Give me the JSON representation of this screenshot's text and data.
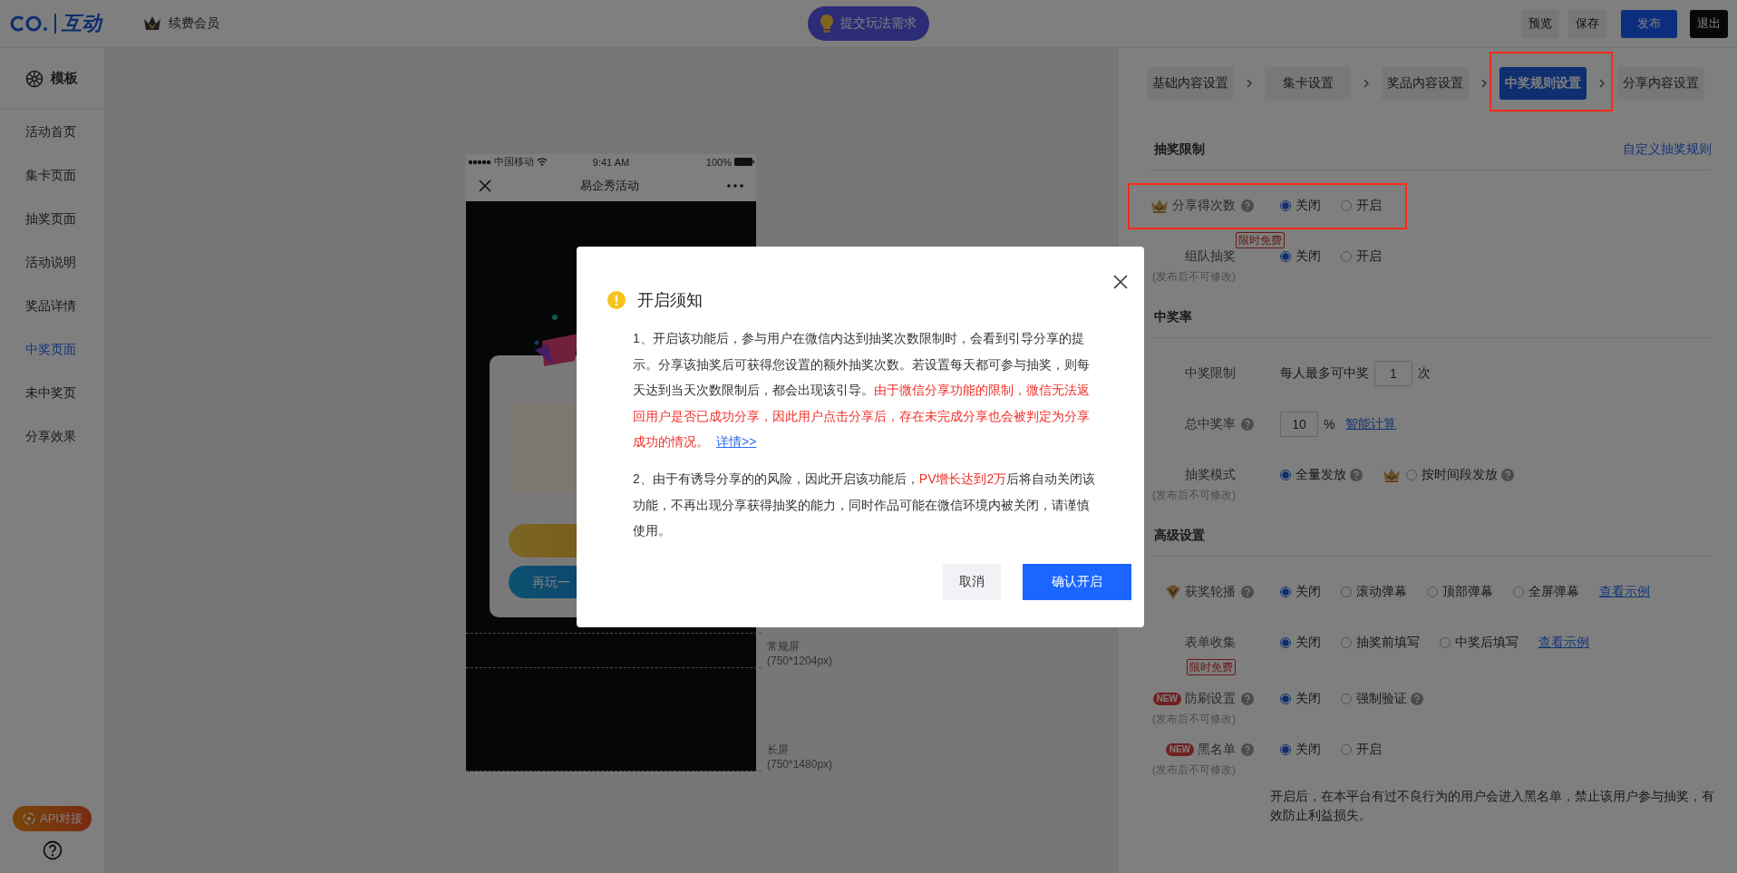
{
  "top_bar": {
    "logo_text": "互动",
    "member": "续费会员",
    "request_button": "提交玩法需求",
    "actions": [
      {
        "label": "预览",
        "kind": "plain"
      },
      {
        "label": "保存",
        "kind": "plain"
      },
      {
        "label": "发布",
        "kind": "primary"
      },
      {
        "label": "退出",
        "kind": "dark"
      }
    ]
  },
  "sidebar": {
    "header": "模板",
    "items": [
      {
        "label": "活动首页",
        "selected": false
      },
      {
        "label": "集卡页面",
        "selected": false
      },
      {
        "label": "抽奖页面",
        "selected": false
      },
      {
        "label": "活动说明",
        "selected": false
      },
      {
        "label": "奖品详情",
        "selected": false
      },
      {
        "label": "中奖页面",
        "selected": true
      },
      {
        "label": "未中奖页",
        "selected": false
      },
      {
        "label": "分享效果",
        "selected": false
      }
    ],
    "api_button": "API对接"
  },
  "phone": {
    "carrier": "中国移动",
    "time": "9:41 AM",
    "battery": "100%",
    "title": "易企秀活动",
    "replay_button": "再玩一",
    "screen_sizes": [
      {
        "name": "常规屏",
        "size": "(750*1204px)"
      },
      {
        "name": "长屏",
        "size": "(750*1480px)"
      }
    ]
  },
  "steps": [
    {
      "label": "基础内容设置",
      "selected": false,
      "highlighted": false
    },
    {
      "label": "集卡设置",
      "selected": false,
      "highlighted": false
    },
    {
      "label": "奖品内容设置",
      "selected": false,
      "highlighted": false
    },
    {
      "label": "中奖规则设置",
      "selected": true,
      "highlighted": true
    },
    {
      "label": "分享内容设置",
      "selected": false,
      "highlighted": false
    }
  ],
  "sections": [
    {
      "title": "抽奖限制",
      "link": "自定义抽奖规则",
      "rows": [
        {
          "kind": "radio",
          "label": "分享得次数",
          "help": true,
          "highlighted": true,
          "options": [
            {
              "label": "关闭",
              "selected": true
            },
            {
              "label": "开启",
              "selected": false
            }
          ]
        },
        {
          "kind": "radio",
          "label": "组队抽奖",
          "badge": "限时免费",
          "note": "(发布后不可修改)",
          "options": [
            {
              "label": "关闭",
              "selected": true
            },
            {
              "label": "开启",
              "selected": false
            }
          ]
        }
      ]
    },
    {
      "title": "中奖率",
      "rows": [
        {
          "kind": "limit",
          "label": "中奖限制",
          "prefix": "每人最多可中奖",
          "value": "1",
          "suffix": "次"
        },
        {
          "kind": "rate",
          "label": "总中奖率",
          "help": true,
          "value": "10",
          "suffix": "%",
          "link": "智能计算"
        },
        {
          "kind": "radio",
          "label": "抽奖模式",
          "note": "(发布后不可修改)",
          "options": [
            {
              "label": "全量发放",
              "selected": true,
              "help": true
            },
            {
              "label": "按时间段发放",
              "selected": false,
              "help": true
            }
          ]
        }
      ]
    },
    {
      "title": "高级设置",
      "rows": [
        {
          "kind": "radio",
          "label": "获奖轮播",
          "help": true,
          "options": [
            {
              "label": "关闭",
              "selected": true
            },
            {
              "label": "滚动弹幕",
              "selected": false
            },
            {
              "label": "顶部弹幕",
              "selected": false
            },
            {
              "label": "全屏弹幕",
              "selected": false
            }
          ],
          "link": "查看示例"
        },
        {
          "kind": "radio",
          "label": "表单收集",
          "badge": "限时免费",
          "options": [
            {
              "label": "关闭",
              "selected": true
            },
            {
              "label": "抽奖前填写",
              "selected": false
            },
            {
              "label": "中奖后填写",
              "selected": false
            }
          ],
          "link": "查看示例"
        },
        {
          "kind": "radio",
          "label": "防刷设置",
          "tag": "NEW",
          "help": true,
          "note": "(发布后不可修改)",
          "options": [
            {
              "label": "关闭",
              "selected": true
            },
            {
              "label": "强制验证",
              "selected": false,
              "help": true
            }
          ]
        },
        {
          "kind": "radio",
          "label": "黑名单",
          "tag": "NEW",
          "help": true,
          "note": "(发布后不可修改)",
          "options": [
            {
              "label": "关闭",
              "selected": true
            },
            {
              "label": "开启",
              "selected": false
            }
          ],
          "description": "开启后，在本平台有过不良行为的用户会进入黑名单，禁止该用户参与抽奖，有效防止利益损失。"
        }
      ]
    }
  ],
  "modal": {
    "title": "开启须知",
    "paragraphs": [
      [
        {
          "kind": "normal",
          "text": "1、开启该功能后，参与用户在微信内达到抽奖次数限制时，会看到引导分享的提示。分享该抽奖后可获得您设置的额外抽奖次数。若设置每天都可参与抽奖，则每天达到当天次数限制后，都会出现该引导。"
        },
        {
          "kind": "warning",
          "text": "由于微信分享功能的限制，微信无法返回用户是否已成功分享，因此用户点击分享后，存在未完成分享也会被判定为分享成功的情况。"
        },
        {
          "kind": "link",
          "text": "详情>>"
        }
      ],
      [
        {
          "kind": "normal",
          "text": "2、由于有诱导分享的的风险，因此开启该功能后，"
        },
        {
          "kind": "warning",
          "text": "PV增长达到2万"
        },
        {
          "kind": "normal",
          "text": "后将自动关闭该功能，不再出现分享获得抽奖的能力，同时作品可能在微信环境内被关闭，请谨慎使用。"
        }
      ]
    ],
    "cancel": "取消",
    "confirm": "确认开启"
  }
}
